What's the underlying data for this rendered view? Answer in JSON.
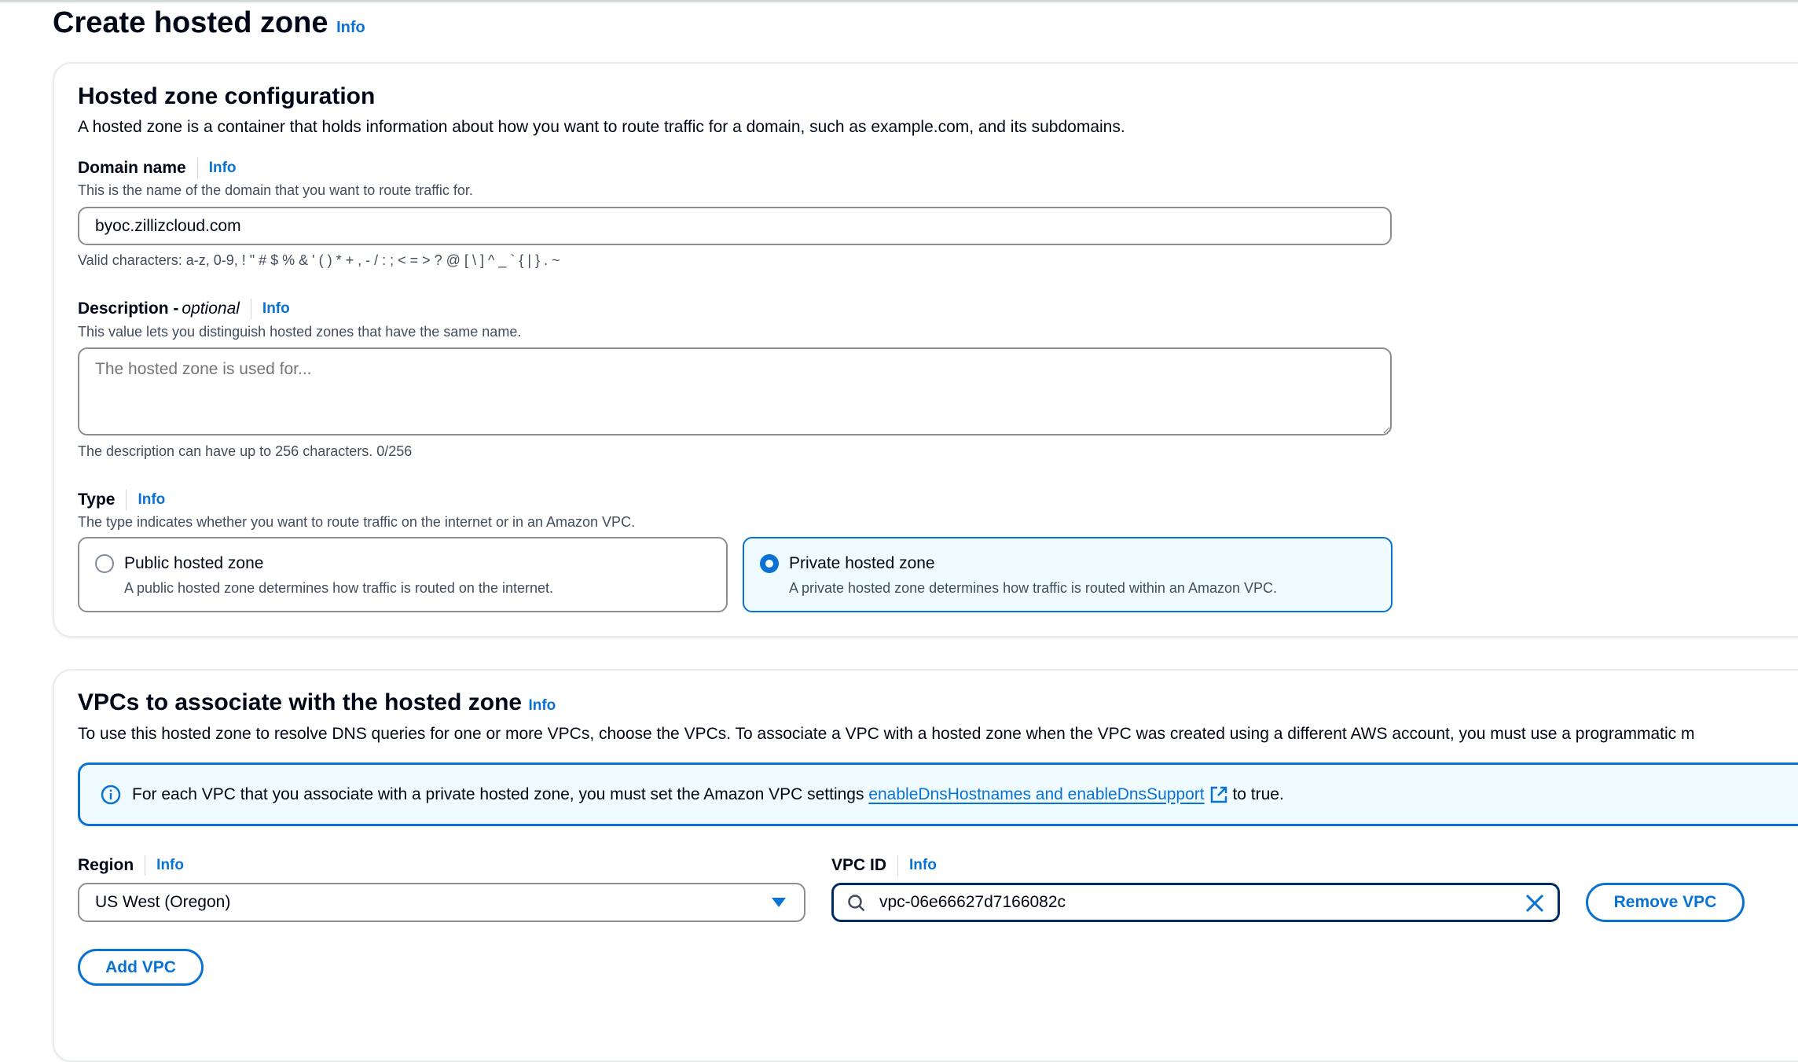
{
  "page": {
    "title": "Create hosted zone",
    "info": "Info"
  },
  "config": {
    "title": "Hosted zone configuration",
    "description": "A hosted zone is a container that holds information about how you want to route traffic for a domain, such as example.com, and its subdomains.",
    "domain": {
      "label": "Domain name",
      "info": "Info",
      "hint": "This is the name of the domain that you want to route traffic for.",
      "value": "byoc.zillizcloud.com",
      "constraint": "Valid characters: a-z, 0-9, ! \" # $ % & ' ( ) * + , - / : ; < = > ? @ [ \\ ] ^ _ ` { | } . ~"
    },
    "description_field": {
      "label": "Description - ",
      "label_optional": "optional",
      "info": "Info",
      "hint": "This value lets you distinguish hosted zones that have the same name.",
      "placeholder": "The hosted zone is used for...",
      "value": "",
      "counter": "The description can have up to 256 characters. 0/256"
    },
    "type": {
      "label": "Type",
      "info": "Info",
      "hint": "The type indicates whether you want to route traffic on the internet or in an Amazon VPC.",
      "options": [
        {
          "title": "Public hosted zone",
          "desc": "A public hosted zone determines how traffic is routed on the internet.",
          "selected": false
        },
        {
          "title": "Private hosted zone",
          "desc": "A private hosted zone determines how traffic is routed within an Amazon VPC.",
          "selected": true
        }
      ]
    }
  },
  "vpcs": {
    "title": "VPCs to associate with the hosted zone",
    "info": "Info",
    "description": "To use this hosted zone to resolve DNS queries for one or more VPCs, choose the VPCs. To associate a VPC with a hosted zone when the VPC was created using a different AWS account, you must use a programmatic m",
    "alert": {
      "icon": "info-circle-icon",
      "before": "For each VPC that you associate with a private hosted zone, you must set the Amazon VPC settings ",
      "link": "enableDnsHostnames and enableDnsSupport",
      "after": " to true."
    },
    "region": {
      "label": "Region",
      "info": "Info",
      "value": "US West (Oregon)"
    },
    "vpc_id": {
      "label": "VPC ID",
      "info": "Info",
      "value": "vpc-06e66627d7166082c"
    },
    "remove_label": "Remove VPC",
    "add_label": "Add VPC"
  },
  "colors": {
    "accent": "#0972d3",
    "selected_bg": "#f0fbff",
    "text": "#000716"
  }
}
